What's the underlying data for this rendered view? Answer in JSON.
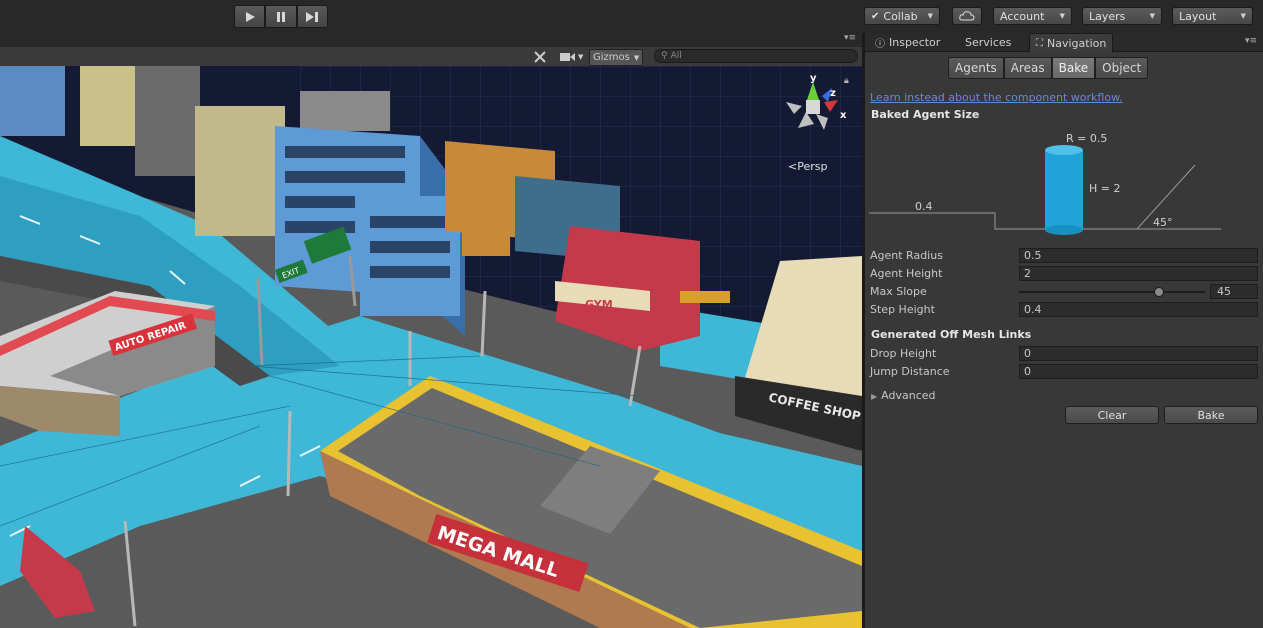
{
  "toolbar": {
    "play_icon": "play-icon",
    "pause_icon": "pause-icon",
    "step_icon": "step-icon",
    "collab_label": "Collab",
    "cloud_icon": "cloud-icon",
    "account_label": "Account",
    "layers_label": "Layers",
    "layout_label": "Layout"
  },
  "scene": {
    "gizmos_label": "Gizmos",
    "search_placeholder": "All",
    "persp_label": "Persp",
    "axis_x": "x",
    "axis_y": "y",
    "axis_z": "z",
    "signs": {
      "exit": "EXIT",
      "auto_repair": "AUTO REPAIR",
      "gym": "GYM",
      "coffee_shop": "COFFEE SHOP",
      "mega_mall": "MEGA MALL"
    }
  },
  "right_tabs": {
    "inspector": "Inspector",
    "services": "Services",
    "navigation": "Navigation"
  },
  "nav": {
    "segments": [
      "Agents",
      "Areas",
      "Bake",
      "Object"
    ],
    "selected_segment": "Bake",
    "link_text": "Learn instead about the component workflow.",
    "baked_agent_size_title": "Baked Agent Size",
    "diagram": {
      "radius_label": "R = 0.5",
      "height_label": "H = 2",
      "step_label": "0.4",
      "slope_label": "45°"
    },
    "fields": [
      {
        "label": "Agent Radius",
        "value": "0.5"
      },
      {
        "label": "Agent Height",
        "value": "2"
      },
      {
        "label": "Max Slope",
        "value": "45"
      },
      {
        "label": "Step Height",
        "value": "0.4"
      }
    ],
    "max_slope_fraction": 0.75,
    "offmesh_title": "Generated Off Mesh Links",
    "offmesh_fields": [
      {
        "label": "Drop Height",
        "value": "0"
      },
      {
        "label": "Jump Distance",
        "value": "0"
      }
    ],
    "advanced_label": "Advanced",
    "clear_label": "Clear",
    "bake_label": "Bake"
  },
  "colors": {
    "accent_link": "#5b8fd8",
    "agent_cylinder": "#1fa3d8",
    "road_blue": "#3fb7d6"
  }
}
